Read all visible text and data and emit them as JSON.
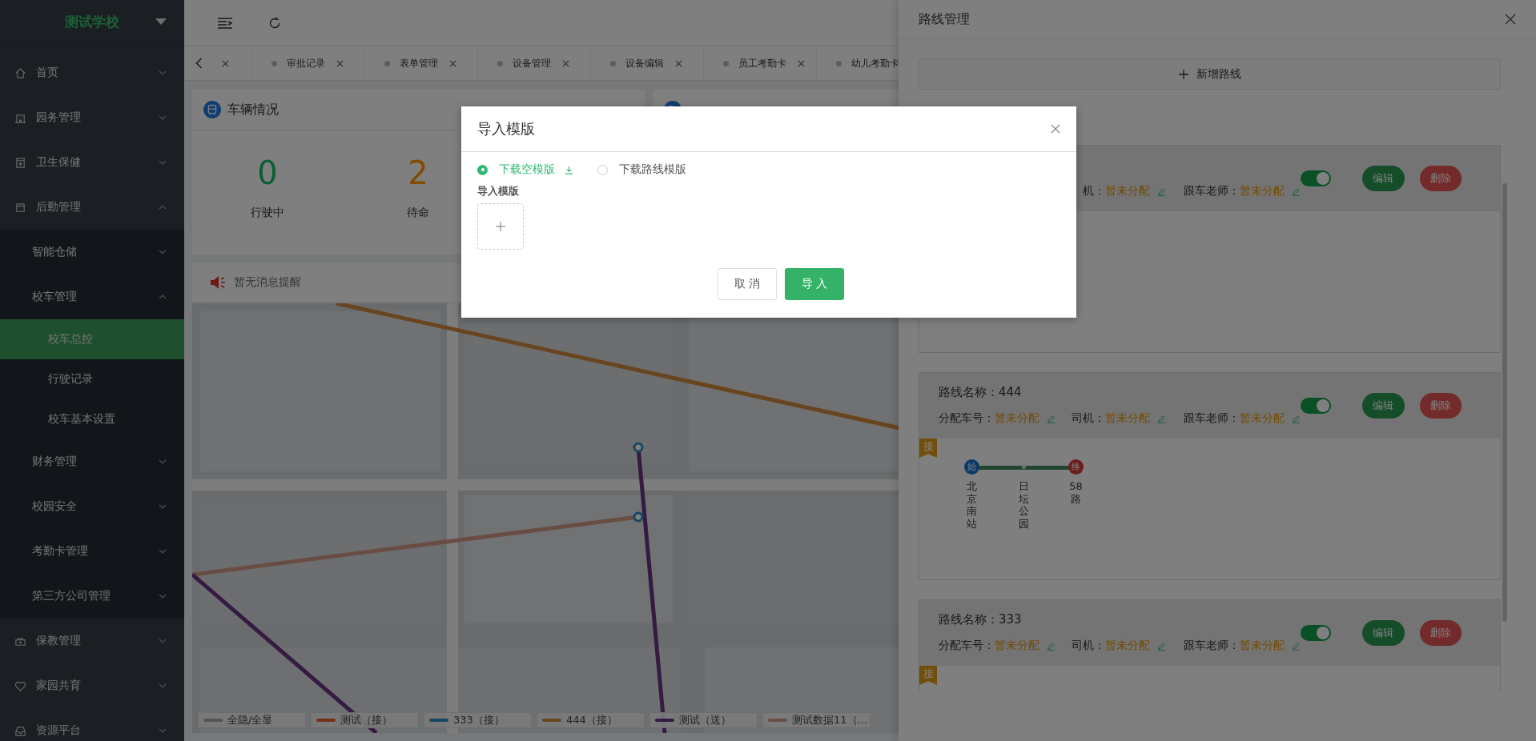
{
  "sidebar": {
    "title": "测试学校",
    "items": [
      {
        "label": "首页",
        "expanded": false,
        "selected": false
      },
      {
        "label": "园务管理",
        "expanded": false,
        "selected": false
      },
      {
        "label": "卫生保健",
        "expanded": false,
        "selected": false
      },
      {
        "label": "后勤管理",
        "expanded": true,
        "selected": false,
        "children": [
          {
            "label": "智能仓储",
            "expanded": false,
            "selected": false
          },
          {
            "label": "校车管理",
            "expanded": true,
            "selected": false,
            "children": [
              {
                "label": "校车总控",
                "selected": true
              },
              {
                "label": "行驶记录",
                "selected": false
              },
              {
                "label": "校车基本设置",
                "selected": false
              }
            ]
          },
          {
            "label": "财务管理",
            "expanded": false,
            "selected": false
          },
          {
            "label": "校园安全",
            "expanded": false,
            "selected": false
          },
          {
            "label": "考勤卡管理",
            "expanded": false,
            "selected": false
          },
          {
            "label": "第三方公司管理",
            "expanded": false,
            "selected": false
          }
        ]
      },
      {
        "label": "保教管理",
        "expanded": false,
        "selected": false
      },
      {
        "label": "家园共育",
        "expanded": false,
        "selected": false
      },
      {
        "label": "资源平台",
        "expanded": false,
        "selected": false
      }
    ]
  },
  "tabs": [
    {
      "selected": false
    },
    {
      "label": "审批记录",
      "selected": false
    },
    {
      "label": "表单管理",
      "selected": false
    },
    {
      "label": "设备管理",
      "selected": false
    },
    {
      "label": "设备编辑",
      "selected": false
    },
    {
      "label": "员工考勤卡",
      "selected": false
    },
    {
      "label": "幼儿考勤卡",
      "selected": false
    }
  ],
  "vehicle_card": {
    "title": "车辆情况",
    "stats": [
      {
        "value": "0",
        "label": "行驶中",
        "color": "#0c5f35"
      },
      {
        "value": "2",
        "label": "待命",
        "color": "#804c00"
      }
    ]
  },
  "notice": {
    "text": "暂无消息提醒"
  },
  "map": {
    "legend": [
      {
        "label": "全隐/全显",
        "color": "#545454"
      },
      {
        "label": "测试（接）",
        "color": "#743016"
      },
      {
        "label": "333（接）",
        "color": "#164762"
      },
      {
        "label": "444（接）",
        "color": "#68451e"
      },
      {
        "label": "测试（送）",
        "color": "#351a42"
      },
      {
        "label": "测试数据11（...",
        "color": "#6a4d43"
      }
    ]
  },
  "drawer": {
    "title": "路线管理",
    "add_button": "新增路线",
    "routes": [
      {
        "fields": [
          {
            "label": "机：",
            "value": "暂未分配"
          },
          {
            "label": "跟车老师：",
            "value": "暂未分配"
          }
        ],
        "on": true,
        "actions": [
          "编辑",
          "删除"
        ]
      },
      {
        "name_label": "路线名称：",
        "name": "444",
        "fields": [
          {
            "label": "分配车号：",
            "value": "暂未分配"
          },
          {
            "label": "司机：",
            "value": "暂未分配"
          },
          {
            "label": "跟车老师：",
            "value": "暂未分配"
          }
        ],
        "on": true,
        "actions": [
          "编辑",
          "删除"
        ],
        "badge": "接",
        "stops": [
          {
            "name": "北京南站",
            "kind": "start",
            "mark": "始"
          },
          {
            "name": "日坛公园",
            "kind": "middle"
          },
          {
            "name": "58路",
            "kind": "end",
            "mark": "终"
          }
        ]
      },
      {
        "name_label": "路线名称：",
        "name": "333",
        "fields": [
          {
            "label": "分配车号：",
            "value": "暂未分配"
          },
          {
            "label": "司机：",
            "value": "暂未分配"
          },
          {
            "label": "跟车老师：",
            "value": "暂未分配"
          }
        ],
        "on": true,
        "actions": [
          "编辑",
          "删除"
        ],
        "badge": "接"
      }
    ]
  },
  "dialog": {
    "title": "导入模版",
    "options": [
      {
        "label": "下载空模版",
        "kind": "blank",
        "selected": true
      },
      {
        "label": "下载路线模版",
        "kind": "route",
        "selected": false
      }
    ],
    "upload_label": "导入模版",
    "buttons": [
      {
        "label": "取 消",
        "kind": "default"
      },
      {
        "label": "导 入",
        "kind": "primary"
      }
    ]
  }
}
